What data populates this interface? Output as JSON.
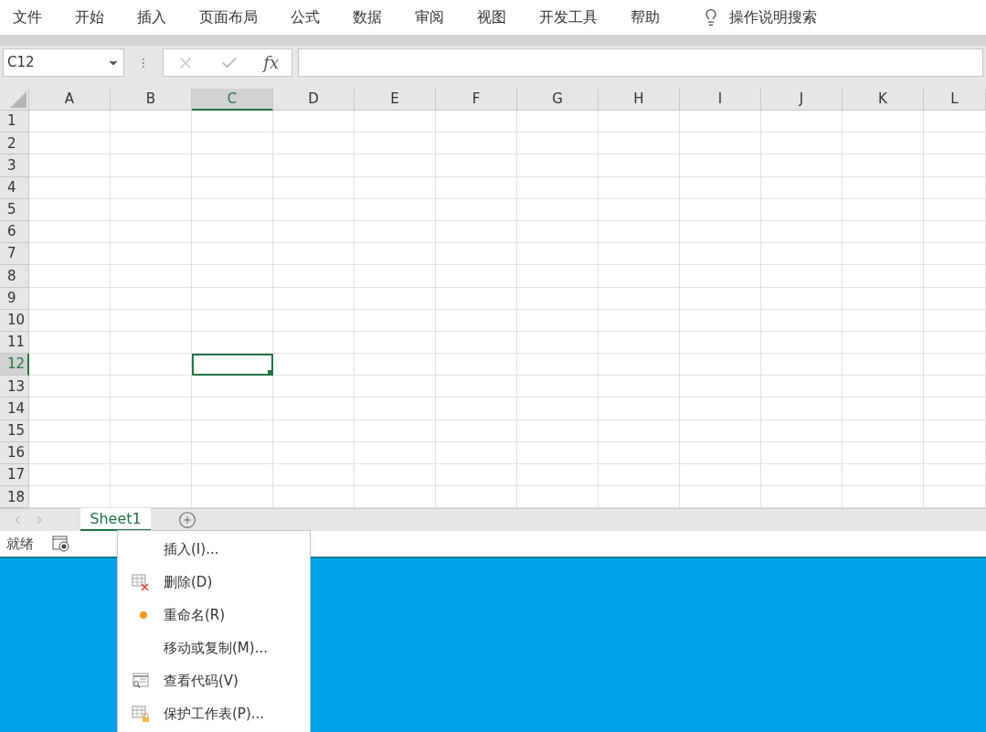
{
  "ribbon_tabs": [
    {
      "label": "文件"
    },
    {
      "label": "开始"
    },
    {
      "label": "插入"
    },
    {
      "label": "页面布局"
    },
    {
      "label": "公式"
    },
    {
      "label": "数据"
    },
    {
      "label": "审阅"
    },
    {
      "label": "视图"
    },
    {
      "label": "开发工具"
    },
    {
      "label": "帮助"
    }
  ],
  "tell_me": {
    "placeholder": "操作说明搜索"
  },
  "formula_bar": {
    "name_box": "C12",
    "fx": "fx"
  },
  "columns": [
    {
      "label": "A",
      "selected": false
    },
    {
      "label": "B",
      "selected": false
    },
    {
      "label": "C",
      "selected": true
    },
    {
      "label": "D",
      "selected": false
    },
    {
      "label": "E",
      "selected": false
    },
    {
      "label": "F",
      "selected": false
    },
    {
      "label": "G",
      "selected": false
    },
    {
      "label": "H",
      "selected": false
    },
    {
      "label": "I",
      "selected": false
    },
    {
      "label": "J",
      "selected": false
    },
    {
      "label": "K",
      "selected": false
    },
    {
      "label": "L",
      "selected": false
    }
  ],
  "rows": [
    {
      "label": "1",
      "selected": false
    },
    {
      "label": "2",
      "selected": false
    },
    {
      "label": "3",
      "selected": false
    },
    {
      "label": "4",
      "selected": false
    },
    {
      "label": "5",
      "selected": false
    },
    {
      "label": "6",
      "selected": false
    },
    {
      "label": "7",
      "selected": false
    },
    {
      "label": "8",
      "selected": false
    },
    {
      "label": "9",
      "selected": false
    },
    {
      "label": "10",
      "selected": false
    },
    {
      "label": "11",
      "selected": false
    },
    {
      "label": "12",
      "selected": true
    },
    {
      "label": "13",
      "selected": false
    },
    {
      "label": "14",
      "selected": false
    },
    {
      "label": "15",
      "selected": false
    },
    {
      "label": "16",
      "selected": false
    },
    {
      "label": "17",
      "selected": false
    },
    {
      "label": "18",
      "selected": false
    }
  ],
  "sheet_tabs": [
    {
      "label": "Sheet1",
      "selected": true
    }
  ],
  "status_bar": {
    "text": "就绪"
  },
  "context_menu": [
    {
      "label": "插入(I)...",
      "kind": "plain"
    },
    {
      "label": "删除(D)",
      "kind": "delete"
    },
    {
      "label": "重命名(R)",
      "kind": "dot"
    },
    {
      "label": "移动或复制(M)...",
      "kind": "plain"
    },
    {
      "label": "查看代码(V)",
      "kind": "code"
    },
    {
      "label": "保护工作表(P)...",
      "kind": "protect"
    }
  ]
}
